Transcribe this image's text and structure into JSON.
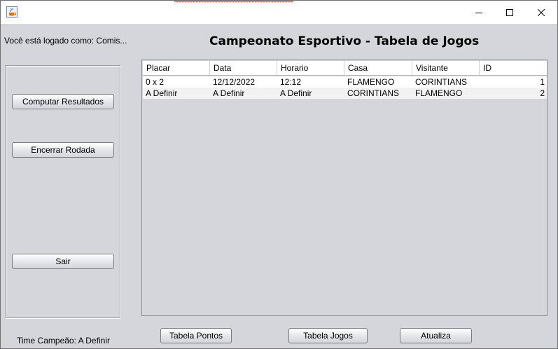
{
  "window": {
    "icon": "java-coffee-cup-icon",
    "controls": [
      "minimize-icon",
      "maximize-icon",
      "close-icon"
    ]
  },
  "user_label": "Você está logado como: Comis...",
  "heading": "Campeonato Esportivo - Tabela de Jogos",
  "sidebar": {
    "compute_label": "Computar Resultados",
    "close_round_label": "Encerrar Rodada",
    "exit_label": "Sair"
  },
  "table": {
    "headers": [
      "Placar",
      "Data",
      "Horario",
      "Casa",
      "Visitante",
      "ID"
    ],
    "rows": [
      [
        "0 x 2",
        "12/12/2022",
        "12:12",
        "FLAMENGO",
        "CORINTIANS",
        "1"
      ],
      [
        "A Definir",
        "A Definir",
        "A Definir",
        "CORINTIANS",
        "FLAMENGO",
        "2"
      ]
    ]
  },
  "champion_label": "Time Campeão: A Definir",
  "footer": {
    "points_label": "Tabela Pontos",
    "games_label": "Tabela Jogos",
    "refresh_label": "Atualiza"
  }
}
